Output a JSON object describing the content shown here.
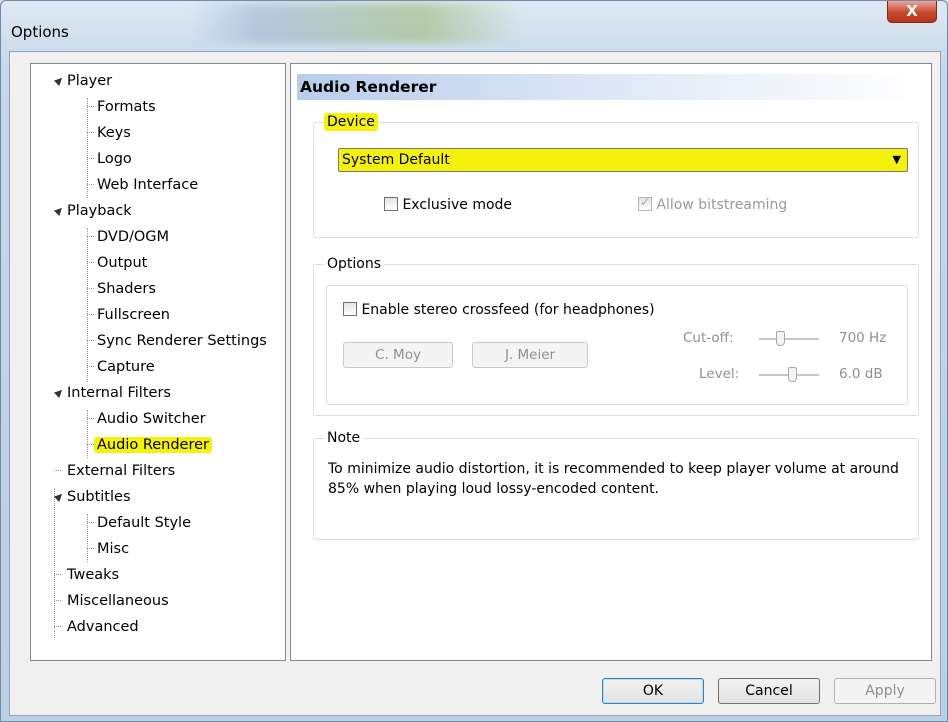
{
  "window": {
    "title": "Options",
    "close_glyph": "X"
  },
  "tree": {
    "nodes": [
      {
        "label": "Player",
        "expanded": true
      },
      {
        "label": "Formats"
      },
      {
        "label": "Keys"
      },
      {
        "label": "Logo"
      },
      {
        "label": "Web Interface"
      },
      {
        "label": "Playback",
        "expanded": true
      },
      {
        "label": "DVD/OGM"
      },
      {
        "label": "Output"
      },
      {
        "label": "Shaders"
      },
      {
        "label": "Fullscreen"
      },
      {
        "label": "Sync Renderer Settings"
      },
      {
        "label": "Capture"
      },
      {
        "label": "Internal Filters",
        "expanded": true
      },
      {
        "label": "Audio Switcher"
      },
      {
        "label": "Audio Renderer",
        "selected": true
      },
      {
        "label": "External Filters"
      },
      {
        "label": "Subtitles",
        "expanded": true
      },
      {
        "label": "Default Style"
      },
      {
        "label": "Misc"
      },
      {
        "label": "Tweaks"
      },
      {
        "label": "Miscellaneous"
      },
      {
        "label": "Advanced"
      }
    ],
    "expand_icon": "▲",
    "highlight_color": "#f4f20c"
  },
  "panel": {
    "header": "Audio Renderer",
    "device": {
      "group_label": "Device",
      "selected": "System Default",
      "dropdown_glyph": "▼",
      "exclusive_mode": {
        "label": "Exclusive mode",
        "checked": false
      },
      "allow_bitstreaming": {
        "label": "Allow bitstreaming",
        "checked": true,
        "enabled": false
      }
    },
    "options": {
      "group_label": "Options",
      "crossfeed": {
        "label": "Enable stereo crossfeed (for headphones)",
        "checked": false
      },
      "cmoy_label": "C. Moy",
      "jmeier_label": "J. Meier",
      "cutoff_label": "Cut-off:",
      "cutoff_value": "700 Hz",
      "level_label": "Level:",
      "level_value": "6.0 dB"
    },
    "note": {
      "group_label": "Note",
      "text": "To minimize audio distortion, it is recommended to keep player volume at around 85% when playing loud lossy-encoded content."
    }
  },
  "footer": {
    "ok_label": "OK",
    "cancel_label": "Cancel",
    "apply_label": "Apply"
  },
  "colors": {
    "highlight": "#f4f20c",
    "close_button": "#c7482f",
    "header_gradient_start": "#b8ccec"
  }
}
